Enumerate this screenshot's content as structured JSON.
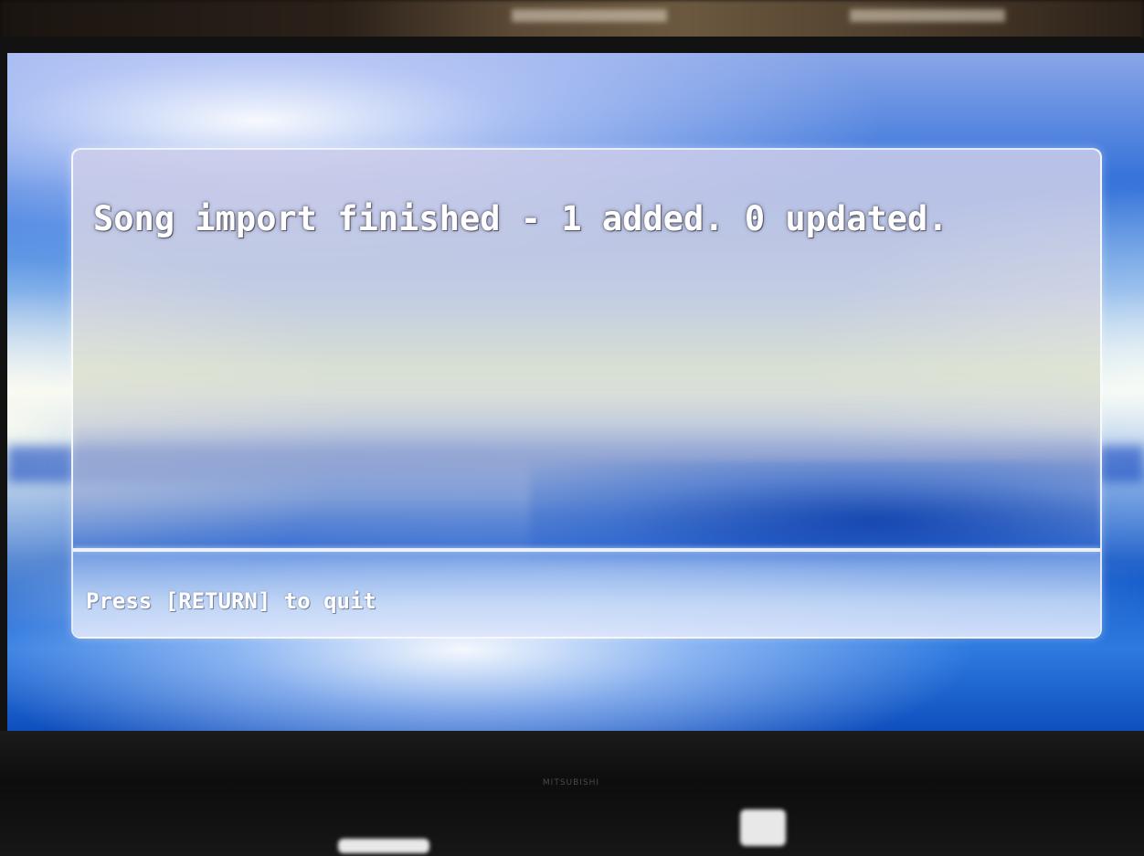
{
  "dialog": {
    "message": "Song import finished - 1 added. 0 updated.",
    "hint": "Press [RETURN] to quit"
  },
  "monitor": {
    "logo_text": "MITSUBISHI"
  },
  "colors": {
    "text": "#ffffff",
    "wallpaper_blue": "#1358c8",
    "dialog_border": "#ffffff"
  }
}
